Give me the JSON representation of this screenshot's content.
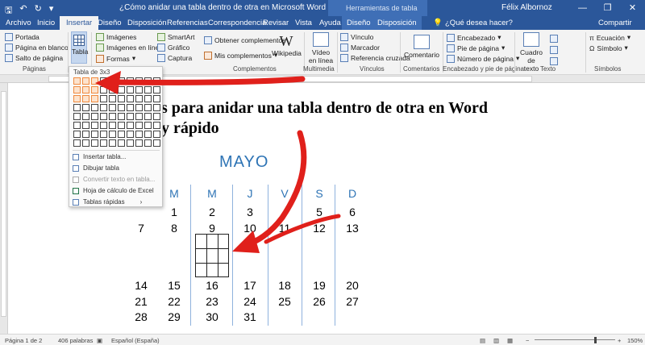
{
  "titlebar": {
    "doc_title": "¿Cómo anidar una tabla dentro de otra en Microsoft Word - Word",
    "context_header": "Herramientas de tabla",
    "user": "Félix Albornoz",
    "minimize": "—",
    "restore": "❐",
    "close": "✕"
  },
  "tabs": [
    "Archivo",
    "Inicio",
    "Insertar",
    "Diseño",
    "Disposición",
    "Referencias",
    "Correspondencia",
    "Revisar",
    "Vista",
    "Ayuda",
    "Diseño",
    "Disposición"
  ],
  "tell_me": "¿Qué desea hacer?",
  "share": "Compartir",
  "ribbon": {
    "paginas": {
      "portada": "Portada",
      "blank": "Página en blanco",
      "break": "Salto de página",
      "label": "Páginas"
    },
    "tabla": {
      "label": "Tabla"
    },
    "ilustraciones": {
      "imagenes": "Imágenes",
      "en_linea": "Imágenes en línea",
      "formas": "Formas",
      "smartart": "SmartArt",
      "grafico": "Gráfico",
      "captura": "Captura"
    },
    "complementos": {
      "obtener": "Obtener complementos",
      "mis": "Mis complementos",
      "wikipedia": "Wikipedia",
      "label": "Complementos"
    },
    "multimedia": {
      "video_line1": "Vídeo",
      "video_line2": "en línea",
      "label": "Multimedia"
    },
    "vinculos": {
      "vinculo": "Vínculo",
      "marcador": "Marcador",
      "ref": "Referencia cruzada",
      "label": "Vínculos"
    },
    "comentarios": {
      "comentario": "Comentario",
      "label": "Comentarios"
    },
    "encabezado": {
      "enc": "Encabezado",
      "pie": "Pie de página",
      "num": "Número de página",
      "label": "Encabezado y pie de página"
    },
    "texto": {
      "cuadro_line1": "Cuadro de",
      "cuadro_line2": "texto",
      "label": "Texto"
    },
    "simbolos": {
      "ecuacion": "Ecuación",
      "simbolo": "Símbolo",
      "label": "Símbolos"
    }
  },
  "document": {
    "heading_line1": "s para anidar una tabla dentro de otra en Word",
    "heading_line2": "y rápido",
    "month": "MAYO",
    "day_headers": [
      "M",
      "M",
      "J",
      "V",
      "S",
      "D"
    ],
    "rows": [
      [
        "",
        "1",
        "2",
        "3",
        "4",
        "5",
        "6"
      ],
      [
        "7",
        "8",
        "9",
        "10",
        "11",
        "12",
        "13"
      ],
      [
        "14",
        "15",
        "16",
        "17",
        "18",
        "19",
        "20"
      ],
      [
        "21",
        "22",
        "23",
        "24",
        "25",
        "26",
        "27"
      ],
      [
        "28",
        "29",
        "30",
        "31",
        "",
        "",
        ""
      ]
    ]
  },
  "dropdown": {
    "title": "Tabla de 3x3",
    "items": [
      "Insertar tabla...",
      "Dibujar tabla",
      "Convertir texto en tabla...",
      "Hoja de cálculo de Excel",
      "Tablas rápidas"
    ]
  },
  "status": {
    "page": "Página 1 de 2",
    "words": "406 palabras",
    "lang": "Español (España)",
    "zoom": "150%"
  },
  "colors": {
    "brand": "#2b579a",
    "accent": "#f08a3e",
    "arrow": "#e0201b",
    "calendar": "#2e74b5"
  }
}
